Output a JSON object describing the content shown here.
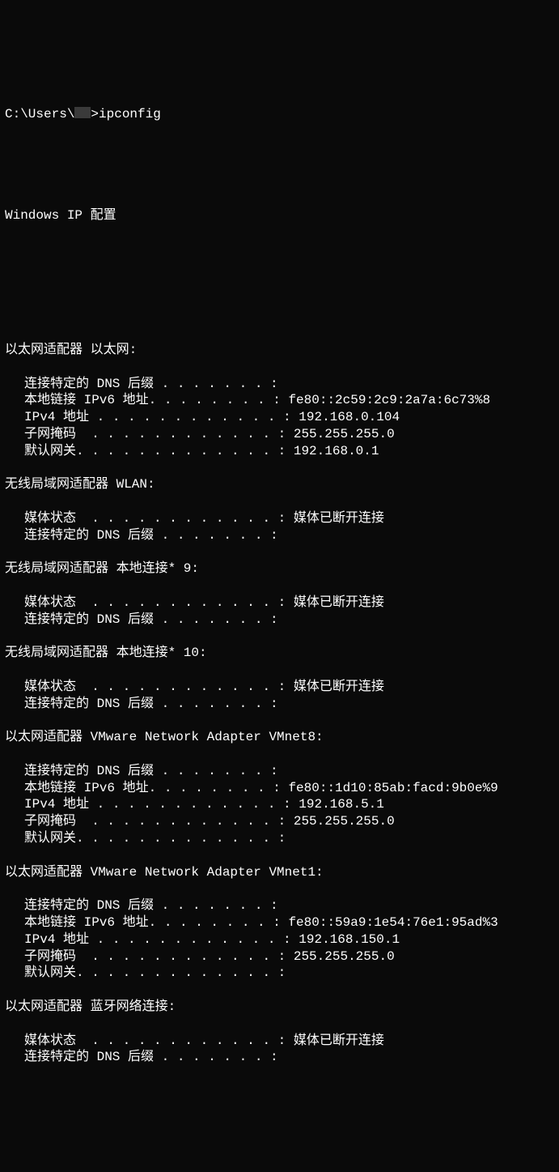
{
  "prompt": {
    "prefix": "C:\\Users\\",
    "suffix": ">ipconfig"
  },
  "header": "Windows IP 配置",
  "adapters": [
    {
      "title": "以太网适配器 以太网:",
      "entries": [
        {
          "label": "连接特定的 DNS 后缀 . . . . . . . :",
          "value": ""
        },
        {
          "label": "本地链接 IPv6 地址. . . . . . . . :",
          "value": " fe80::2c59:2c9:2a7a:6c73%8"
        },
        {
          "label": "IPv4 地址 . . . . . . . . . . . . :",
          "value": " 192.168.0.104"
        },
        {
          "label": "子网掩码  . . . . . . . . . . . . :",
          "value": " 255.255.255.0"
        },
        {
          "label": "默认网关. . . . . . . . . . . . . :",
          "value": " 192.168.0.1"
        }
      ]
    },
    {
      "title": "无线局域网适配器 WLAN:",
      "entries": [
        {
          "label": "媒体状态  . . . . . . . . . . . . :",
          "value": " 媒体已断开连接"
        },
        {
          "label": "连接特定的 DNS 后缀 . . . . . . . :",
          "value": ""
        }
      ]
    },
    {
      "title": "无线局域网适配器 本地连接* 9:",
      "entries": [
        {
          "label": "媒体状态  . . . . . . . . . . . . :",
          "value": " 媒体已断开连接"
        },
        {
          "label": "连接特定的 DNS 后缀 . . . . . . . :",
          "value": ""
        }
      ]
    },
    {
      "title": "无线局域网适配器 本地连接* 10:",
      "entries": [
        {
          "label": "媒体状态  . . . . . . . . . . . . :",
          "value": " 媒体已断开连接"
        },
        {
          "label": "连接特定的 DNS 后缀 . . . . . . . :",
          "value": ""
        }
      ]
    },
    {
      "title": "以太网适配器 VMware Network Adapter VMnet8:",
      "entries": [
        {
          "label": "连接特定的 DNS 后缀 . . . . . . . :",
          "value": ""
        },
        {
          "label": "本地链接 IPv6 地址. . . . . . . . :",
          "value": " fe80::1d10:85ab:facd:9b0e%9"
        },
        {
          "label": "IPv4 地址 . . . . . . . . . . . . :",
          "value": " 192.168.5.1"
        },
        {
          "label": "子网掩码  . . . . . . . . . . . . :",
          "value": " 255.255.255.0"
        },
        {
          "label": "默认网关. . . . . . . . . . . . . :",
          "value": ""
        }
      ]
    },
    {
      "title": "以太网适配器 VMware Network Adapter VMnet1:",
      "entries": [
        {
          "label": "连接特定的 DNS 后缀 . . . . . . . :",
          "value": ""
        },
        {
          "label": "本地链接 IPv6 地址. . . . . . . . :",
          "value": " fe80::59a9:1e54:76e1:95ad%3"
        },
        {
          "label": "IPv4 地址 . . . . . . . . . . . . :",
          "value": " 192.168.150.1"
        },
        {
          "label": "子网掩码  . . . . . . . . . . . . :",
          "value": " 255.255.255.0"
        },
        {
          "label": "默认网关. . . . . . . . . . . . . :",
          "value": ""
        }
      ]
    },
    {
      "title": "以太网适配器 蓝牙网络连接:",
      "entries": [
        {
          "label": "媒体状态  . . . . . . . . . . . . :",
          "value": " 媒体已断开连接"
        },
        {
          "label": "连接特定的 DNS 后缀 . . . . . . . :",
          "value": ""
        }
      ]
    }
  ]
}
